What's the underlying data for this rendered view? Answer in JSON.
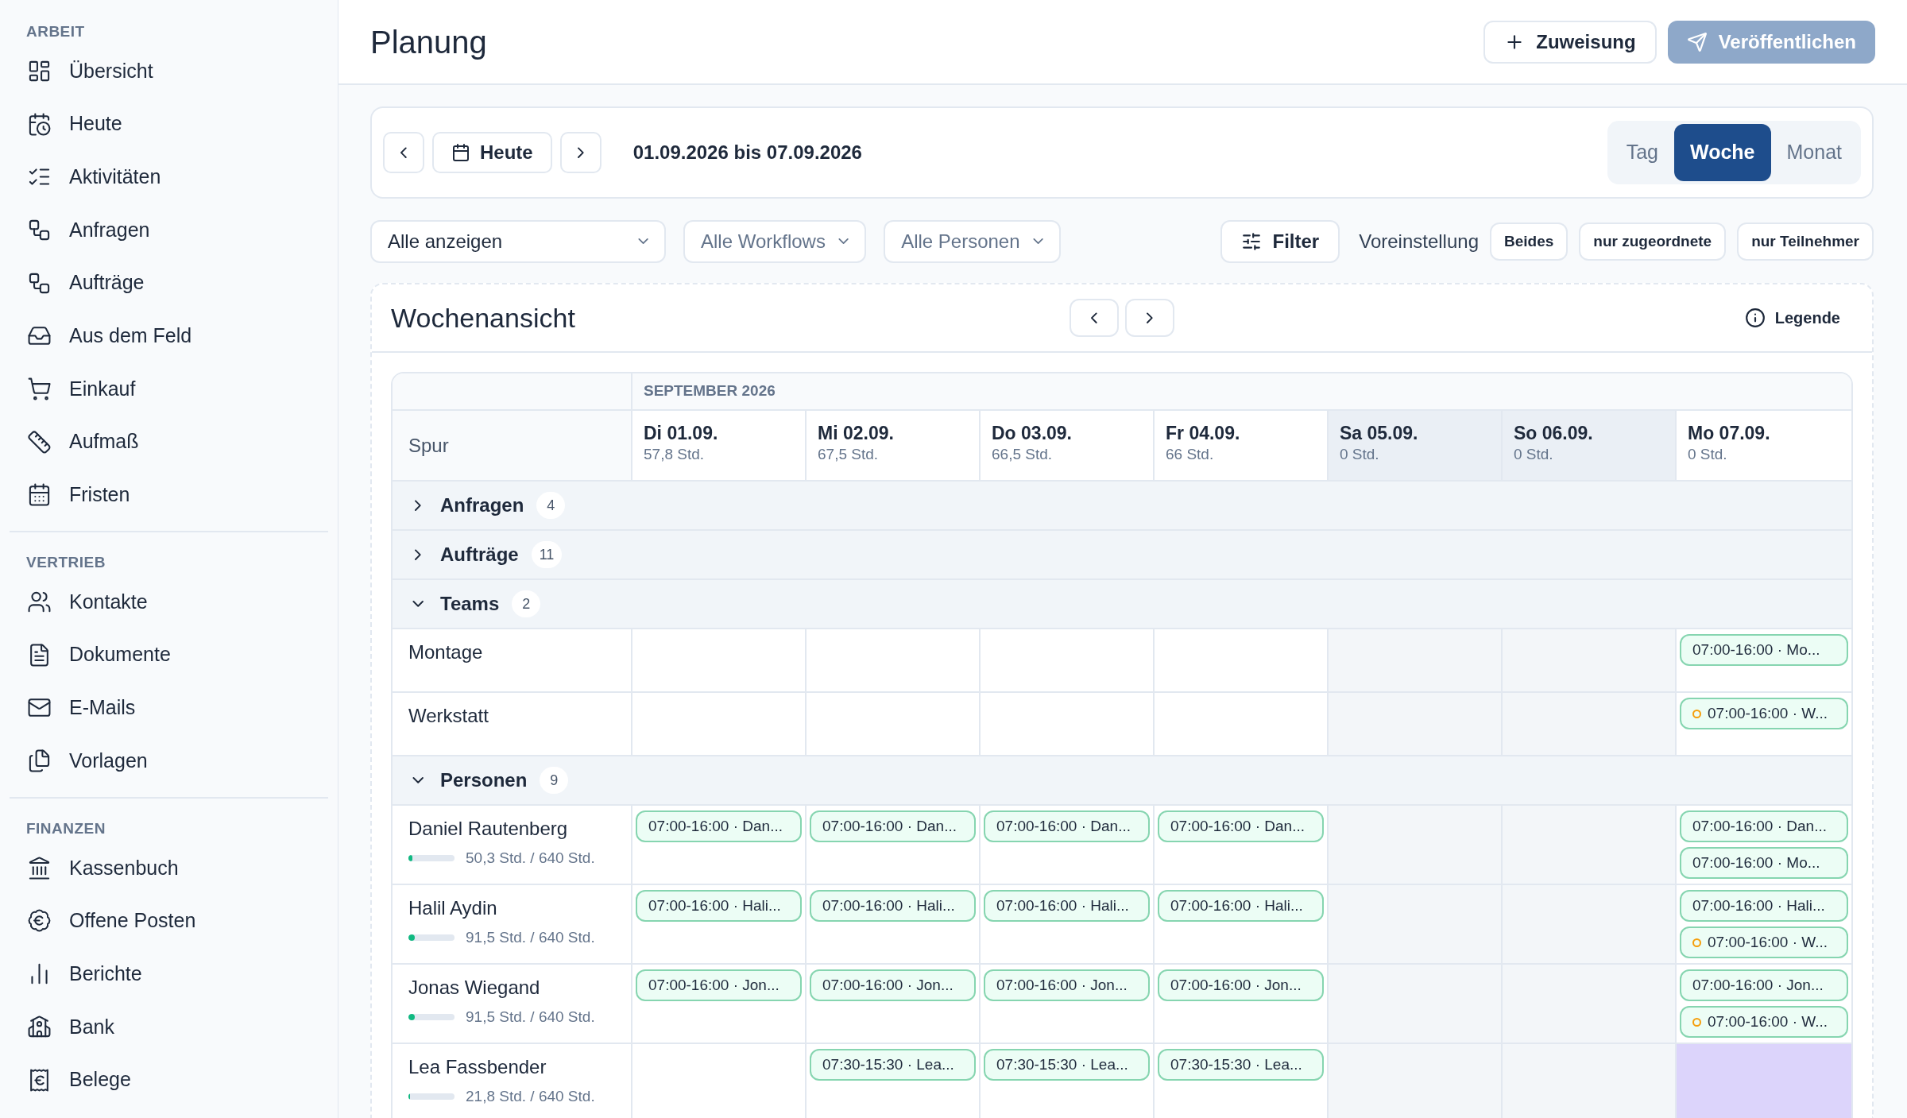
{
  "sidebar": {
    "sections": [
      {
        "label": "ARBEIT",
        "items": [
          {
            "label": "Übersicht"
          },
          {
            "label": "Heute"
          },
          {
            "label": "Aktivitäten"
          },
          {
            "label": "Anfragen"
          },
          {
            "label": "Aufträge"
          },
          {
            "label": "Aus dem Feld"
          },
          {
            "label": "Einkauf"
          },
          {
            "label": "Aufmaß"
          },
          {
            "label": "Fristen"
          }
        ]
      },
      {
        "label": "VERTRIEB",
        "items": [
          {
            "label": "Kontakte"
          },
          {
            "label": "Dokumente"
          },
          {
            "label": "E-Mails"
          },
          {
            "label": "Vorlagen"
          }
        ]
      },
      {
        "label": "FINANZEN",
        "items": [
          {
            "label": "Kassenbuch"
          },
          {
            "label": "Offene Posten"
          },
          {
            "label": "Berichte"
          },
          {
            "label": "Bank"
          },
          {
            "label": "Belege"
          }
        ]
      }
    ]
  },
  "header": {
    "title": "Planung",
    "add_button": "Zuweisung",
    "publish_button": {
      "label": "Veröffentlichen",
      "disabled": true
    }
  },
  "date_bar": {
    "today_button": "Heute",
    "range": "01.09.2026 bis 07.09.2026",
    "views": [
      {
        "label": "Tag",
        "selected": false
      },
      {
        "label": "Woche",
        "selected": true
      },
      {
        "label": "Monat",
        "selected": false
      }
    ]
  },
  "filters": {
    "dropdowns": [
      {
        "value": "Alle anzeigen"
      },
      {
        "placeholder": "Alle Workflows"
      },
      {
        "placeholder": "Alle Personen"
      }
    ],
    "filter_button": "Filter",
    "preset_label": "Voreinstellung",
    "presets": [
      "Beides",
      "nur zugeordnete",
      "nur Teilnehmer"
    ]
  },
  "week_view": {
    "title": "Wochenansicht",
    "legend_button": "Legende",
    "month": "SEPTEMBER 2026",
    "lane_header": "Spur",
    "days": [
      {
        "label": "Di 01.09.",
        "hours": "57,8 Std.",
        "weekend": false
      },
      {
        "label": "Mi 02.09.",
        "hours": "67,5 Std.",
        "weekend": false
      },
      {
        "label": "Do 03.09.",
        "hours": "66,5 Std.",
        "weekend": false
      },
      {
        "label": "Fr 04.09.",
        "hours": "66 Std.",
        "weekend": false
      },
      {
        "label": "Sa 05.09.",
        "hours": "0 Std.",
        "weekend": true
      },
      {
        "label": "So 06.09.",
        "hours": "0 Std.",
        "weekend": true
      },
      {
        "label": "Mo 07.09.",
        "hours": "0 Std.",
        "weekend": false
      }
    ],
    "groups": [
      {
        "label": "Anfragen",
        "count": "4",
        "expanded": false
      },
      {
        "label": "Aufträge",
        "count": "11",
        "expanded": false
      },
      {
        "label": "Teams",
        "count": "2",
        "expanded": true,
        "rows": [
          {
            "name": "Montage",
            "cells": [
              {
                "highlighted": false
              },
              {
                "highlighted": false
              },
              {
                "highlighted": false
              },
              {
                "highlighted": false
              },
              {
                "highlighted": false
              },
              {
                "highlighted": false
              },
              {
                "highlighted": false,
                "chips": [
                  {
                    "text": "07:00-16:00 · Mo...",
                    "status_dot": false
                  }
                ]
              }
            ]
          },
          {
            "name": "Werkstatt",
            "cells": [
              {
                "highlighted": false
              },
              {
                "highlighted": false
              },
              {
                "highlighted": false
              },
              {
                "highlighted": false
              },
              {
                "highlighted": false
              },
              {
                "highlighted": false
              },
              {
                "highlighted": false,
                "chips": [
                  {
                    "text": "07:00-16:00 · W...",
                    "status_dot": true
                  }
                ]
              }
            ]
          }
        ]
      },
      {
        "label": "Personen",
        "count": "9",
        "expanded": true,
        "rows": [
          {
            "name": "Daniel Rautenberg",
            "hours": "50,3 Std. / 640 Std.",
            "level": 0.079,
            "cells": [
              {
                "highlighted": false,
                "chips": [
                  {
                    "text": "07:00-16:00 · Dan...",
                    "status_dot": false
                  }
                ]
              },
              {
                "highlighted": false,
                "chips": [
                  {
                    "text": "07:00-16:00 · Dan...",
                    "status_dot": false
                  }
                ]
              },
              {
                "highlighted": false,
                "chips": [
                  {
                    "text": "07:00-16:00 · Dan...",
                    "status_dot": false
                  }
                ]
              },
              {
                "highlighted": false,
                "chips": [
                  {
                    "text": "07:00-16:00 · Dan...",
                    "status_dot": false
                  }
                ]
              },
              {
                "highlighted": false
              },
              {
                "highlighted": false
              },
              {
                "highlighted": false,
                "chips": [
                  {
                    "text": "07:00-16:00 · Dan...",
                    "status_dot": false
                  },
                  {
                    "text": "07:00-16:00 · Mo...",
                    "status_dot": false
                  }
                ]
              }
            ]
          },
          {
            "name": "Halil Aydin",
            "hours": "91,5 Std. / 640 Std.",
            "level": 0.143,
            "cells": [
              {
                "highlighted": false,
                "chips": [
                  {
                    "text": "07:00-16:00 · Hali...",
                    "status_dot": false
                  }
                ]
              },
              {
                "highlighted": false,
                "chips": [
                  {
                    "text": "07:00-16:00 · Hali...",
                    "status_dot": false
                  }
                ]
              },
              {
                "highlighted": false,
                "chips": [
                  {
                    "text": "07:00-16:00 · Hali...",
                    "status_dot": false
                  }
                ]
              },
              {
                "highlighted": false,
                "chips": [
                  {
                    "text": "07:00-16:00 · Hali...",
                    "status_dot": false
                  }
                ]
              },
              {
                "highlighted": false
              },
              {
                "highlighted": false
              },
              {
                "highlighted": false,
                "chips": [
                  {
                    "text": "07:00-16:00 · Hali...",
                    "status_dot": false
                  },
                  {
                    "text": "07:00-16:00 · W...",
                    "status_dot": true
                  }
                ]
              }
            ]
          },
          {
            "name": "Jonas Wiegand",
            "hours": "91,5 Std. / 640 Std.",
            "level": 0.143,
            "cells": [
              {
                "highlighted": false,
                "chips": [
                  {
                    "text": "07:00-16:00 · Jon...",
                    "status_dot": false
                  }
                ]
              },
              {
                "highlighted": false,
                "chips": [
                  {
                    "text": "07:00-16:00 · Jon...",
                    "status_dot": false
                  }
                ]
              },
              {
                "highlighted": false,
                "chips": [
                  {
                    "text": "07:00-16:00 · Jon...",
                    "status_dot": false
                  }
                ]
              },
              {
                "highlighted": false,
                "chips": [
                  {
                    "text": "07:00-16:00 · Jon...",
                    "status_dot": false
                  }
                ]
              },
              {
                "highlighted": false
              },
              {
                "highlighted": false
              },
              {
                "highlighted": false,
                "chips": [
                  {
                    "text": "07:00-16:00 · Jon...",
                    "status_dot": false
                  },
                  {
                    "text": "07:00-16:00 · W...",
                    "status_dot": true
                  }
                ]
              }
            ]
          },
          {
            "name": "Lea Fassbender",
            "hours": "21,8 Std. / 640 Std.",
            "level": 0.034,
            "cells": [
              {
                "highlighted": false
              },
              {
                "highlighted": false,
                "chips": [
                  {
                    "text": "07:30-15:30 · Lea...",
                    "status_dot": false
                  }
                ]
              },
              {
                "highlighted": false,
                "chips": [
                  {
                    "text": "07:30-15:30 · Lea...",
                    "status_dot": false
                  }
                ]
              },
              {
                "highlighted": false,
                "chips": [
                  {
                    "text": "07:30-15:30 · Lea...",
                    "status_dot": false
                  }
                ]
              },
              {
                "highlighted": false
              },
              {
                "highlighted": false
              },
              {
                "highlighted": true
              }
            ]
          }
        ]
      }
    ]
  }
}
